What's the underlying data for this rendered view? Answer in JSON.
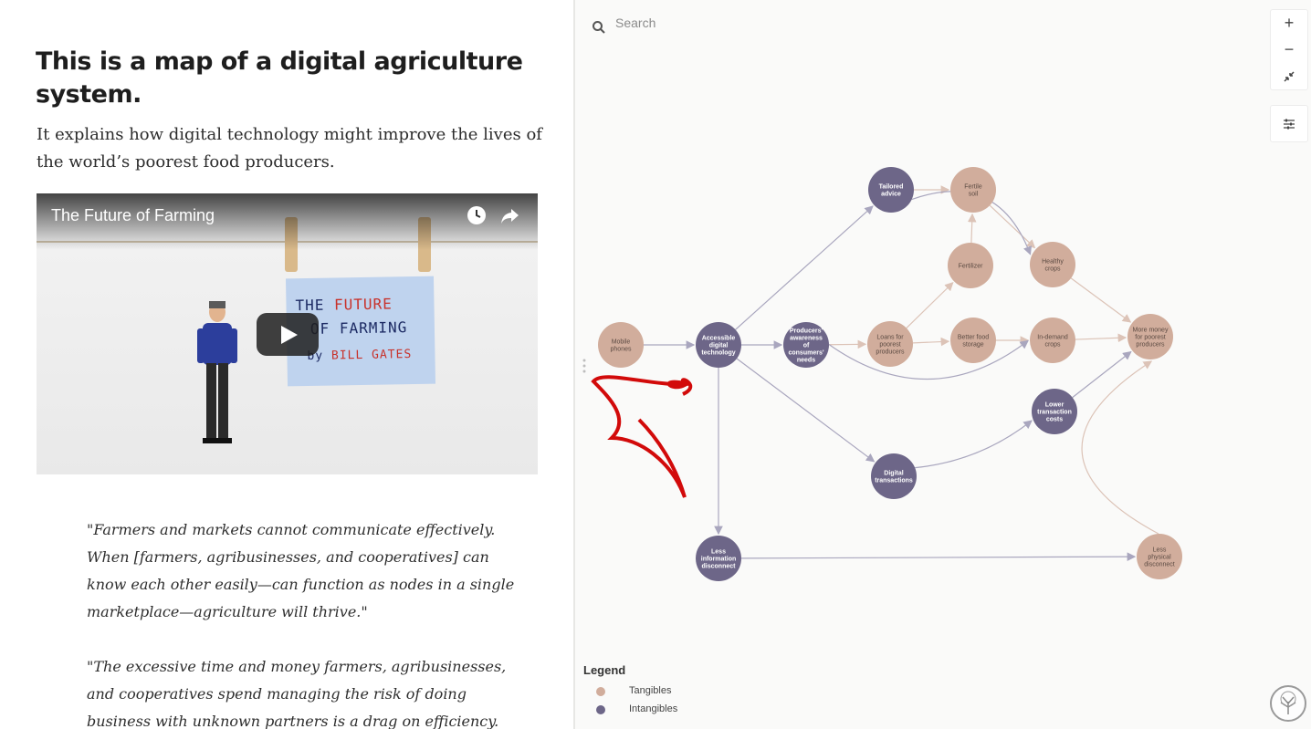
{
  "article": {
    "title": "This is a map of a digital agriculture system.",
    "lede": "It explains how digital technology might improve the lives of the world’s poorest food producers.",
    "video": {
      "title": "The Future of Farming",
      "card_line1_a": "THE ",
      "card_line1_b": "FUTURE",
      "card_line2_a": "OF ",
      "card_line2_b": "FARMING",
      "card_line3_a": "by ",
      "card_line3_b": "BILL GATES",
      "icons": [
        "clock-icon",
        "share-icon",
        "play-icon"
      ]
    },
    "quotes": [
      "\"Farmers and markets cannot communicate effectively. When [farmers, agribusinesses, and cooperatives] can know each other easily—can function as nodes in a single marketplace—agriculture will thrive.\"",
      "\"The excessive time and money farmers, agribusinesses, and cooperatives spend managing the risk of doing business with unknown partners is a drag on efficiency."
    ]
  },
  "map": {
    "search_placeholder": "Search",
    "controls": {
      "zoom_in": "+",
      "zoom_out": "−",
      "icons": [
        "zoom-in-icon",
        "zoom-out-icon",
        "collapse-icon",
        "filter-icon",
        "search-icon"
      ]
    },
    "colors": {
      "tangible": "#d1ad9c",
      "intangible": "#6d6688",
      "edge": "#a9a6be"
    },
    "nodes": [
      {
        "id": "mobile",
        "label": "Mobile phones",
        "kind": "tangible"
      },
      {
        "id": "access",
        "label": "Accessible digital technology",
        "kind": "intangible"
      },
      {
        "id": "aware",
        "label": "Producers' awareness of consumers' needs",
        "kind": "intangible"
      },
      {
        "id": "tailored",
        "label": "Tailored advice",
        "kind": "intangible"
      },
      {
        "id": "fertile",
        "label": "Fertile soil",
        "kind": "tangible"
      },
      {
        "id": "fertilizer",
        "label": "Fertilizer",
        "kind": "tangible"
      },
      {
        "id": "healthy",
        "label": "Healthy crops",
        "kind": "tangible"
      },
      {
        "id": "loans",
        "label": "Loans for poorest producers",
        "kind": "tangible"
      },
      {
        "id": "storage",
        "label": "Better food storage",
        "kind": "tangible"
      },
      {
        "id": "indemand",
        "label": "In-demand crops",
        "kind": "tangible"
      },
      {
        "id": "money",
        "label": "More money for poorest producers",
        "kind": "tangible"
      },
      {
        "id": "lower",
        "label": "Lower transaction costs",
        "kind": "intangible"
      },
      {
        "id": "digital",
        "label": "Digital transactions",
        "kind": "intangible"
      },
      {
        "id": "lessinfo",
        "label": "Less information disconnect",
        "kind": "intangible"
      },
      {
        "id": "lessphys",
        "label": "Less physical disconnect",
        "kind": "tangible"
      }
    ],
    "legend": {
      "title": "Legend",
      "items": [
        {
          "label": "Tangibles",
          "color": "#d1ad9c"
        },
        {
          "label": "Intangibles",
          "color": "#6d6688"
        }
      ]
    }
  }
}
